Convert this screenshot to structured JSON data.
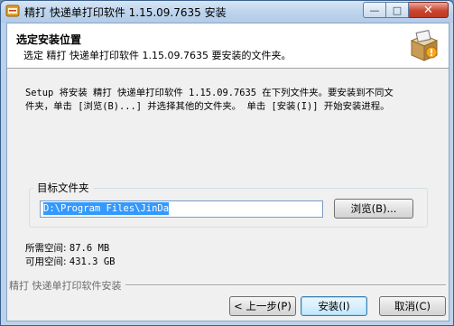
{
  "window": {
    "title": "精打 快递单打印软件 1.15.09.7635 安装",
    "minimize_glyph": "—",
    "maximize_glyph": "□",
    "close_glyph": "✕"
  },
  "header": {
    "title": "选定安装位置",
    "subtitle": "选定 精打 快递单打印软件 1.15.09.7635 要安装的文件夹。",
    "icon": "installer-box-icon"
  },
  "description": {
    "line1": "Setup 将安装 精打 快递单打印软件 1.15.09.7635 在下列文件夹。要安装到不同文",
    "line2": "件夹，单击 [浏览(B)...] 并选择其他的文件夹。 单击 [安装(I)] 开始安装进程。"
  },
  "destination": {
    "label": "目标文件夹",
    "path": "D:\\Program Files\\JinDa",
    "browse_label": "浏览(B)..."
  },
  "space": {
    "required_label": "所需空间:",
    "required_value": "87.6 MB",
    "available_label": "可用空间:",
    "available_value": "431.3 GB"
  },
  "footer": {
    "brand": "精打 快递单打印软件安装",
    "back_label": "< 上一步(P)",
    "install_label": "安装(I)",
    "cancel_label": "取消(C)"
  },
  "colors": {
    "title_bar": "#bcd3ec",
    "close_button": "#c9452f",
    "selection": "#3399ff",
    "default_button_border": "#3c7fb1"
  }
}
